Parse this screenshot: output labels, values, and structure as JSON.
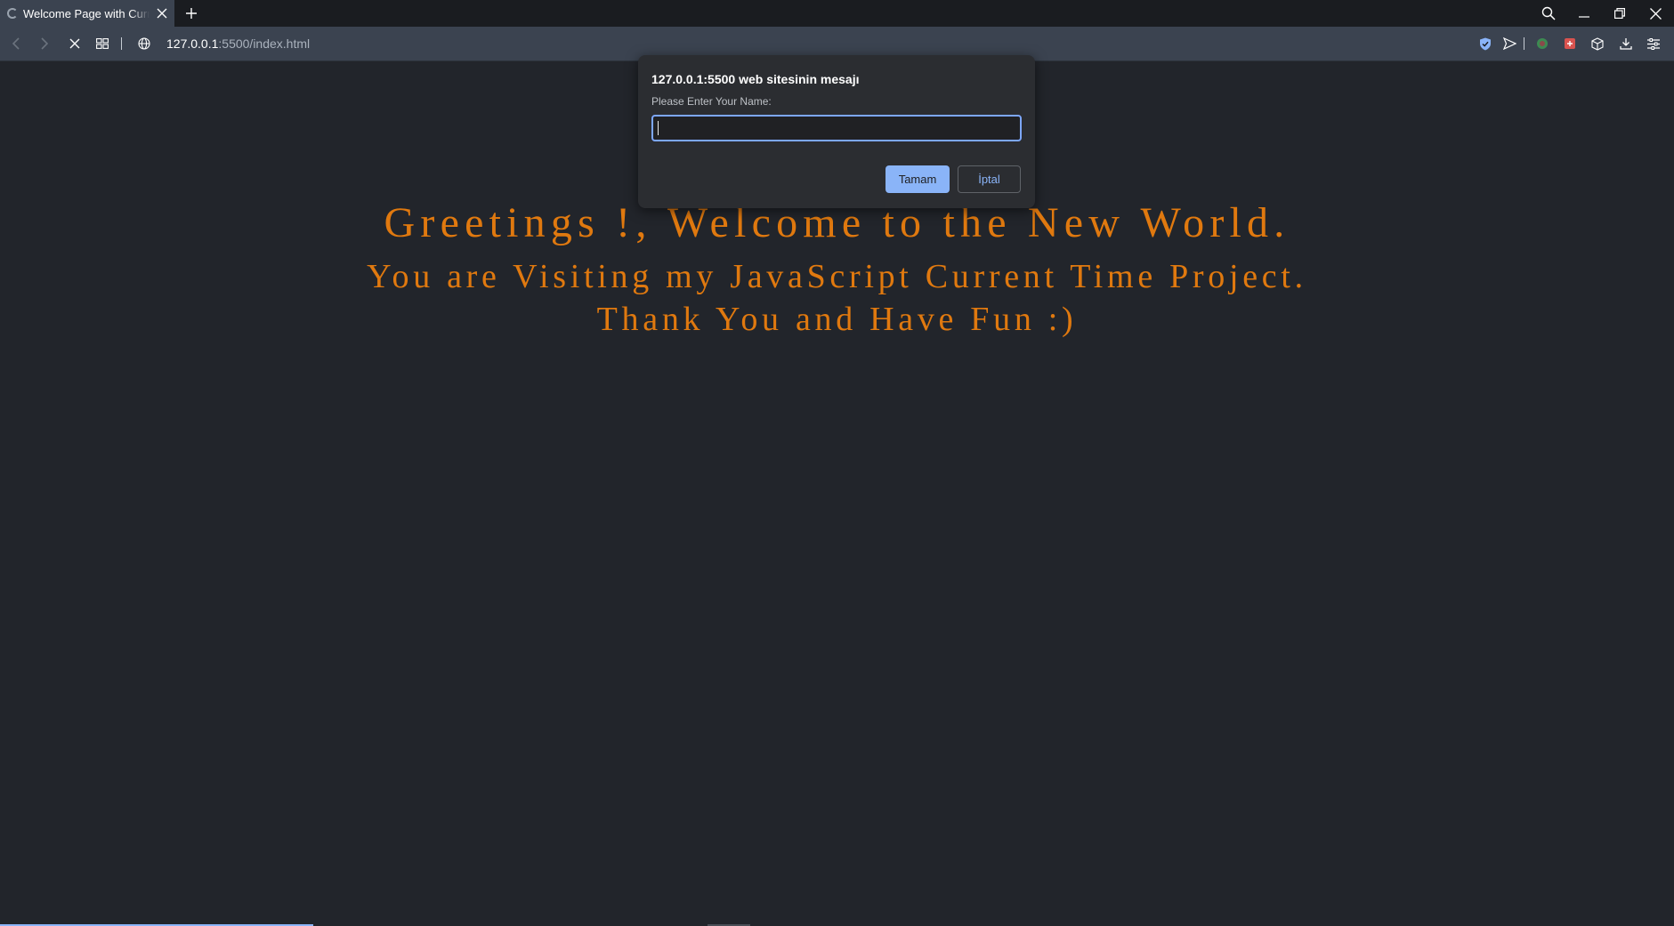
{
  "browser": {
    "tab": {
      "title": "Welcome Page with Current Time",
      "icon": "loading-spinner-icon"
    },
    "new_tab_label": "+",
    "url": {
      "host": "127.0.0.1",
      "rest": ":5500/index.html"
    },
    "accent_color": "#8ab4f8"
  },
  "page": {
    "line1": "Greetings !, Welcome to the New World.",
    "line2": "You are Visiting my JavaScript Current Time Project.",
    "line3": "Thank You and Have Fun :)",
    "text_color": "#e0790f",
    "background_color": "#22252b"
  },
  "dialog": {
    "title": "127.0.0.1:5500 web sitesinin mesajı",
    "message": "Please Enter Your Name:",
    "input_value": "",
    "ok_label": "Tamam",
    "cancel_label": "İptal"
  }
}
